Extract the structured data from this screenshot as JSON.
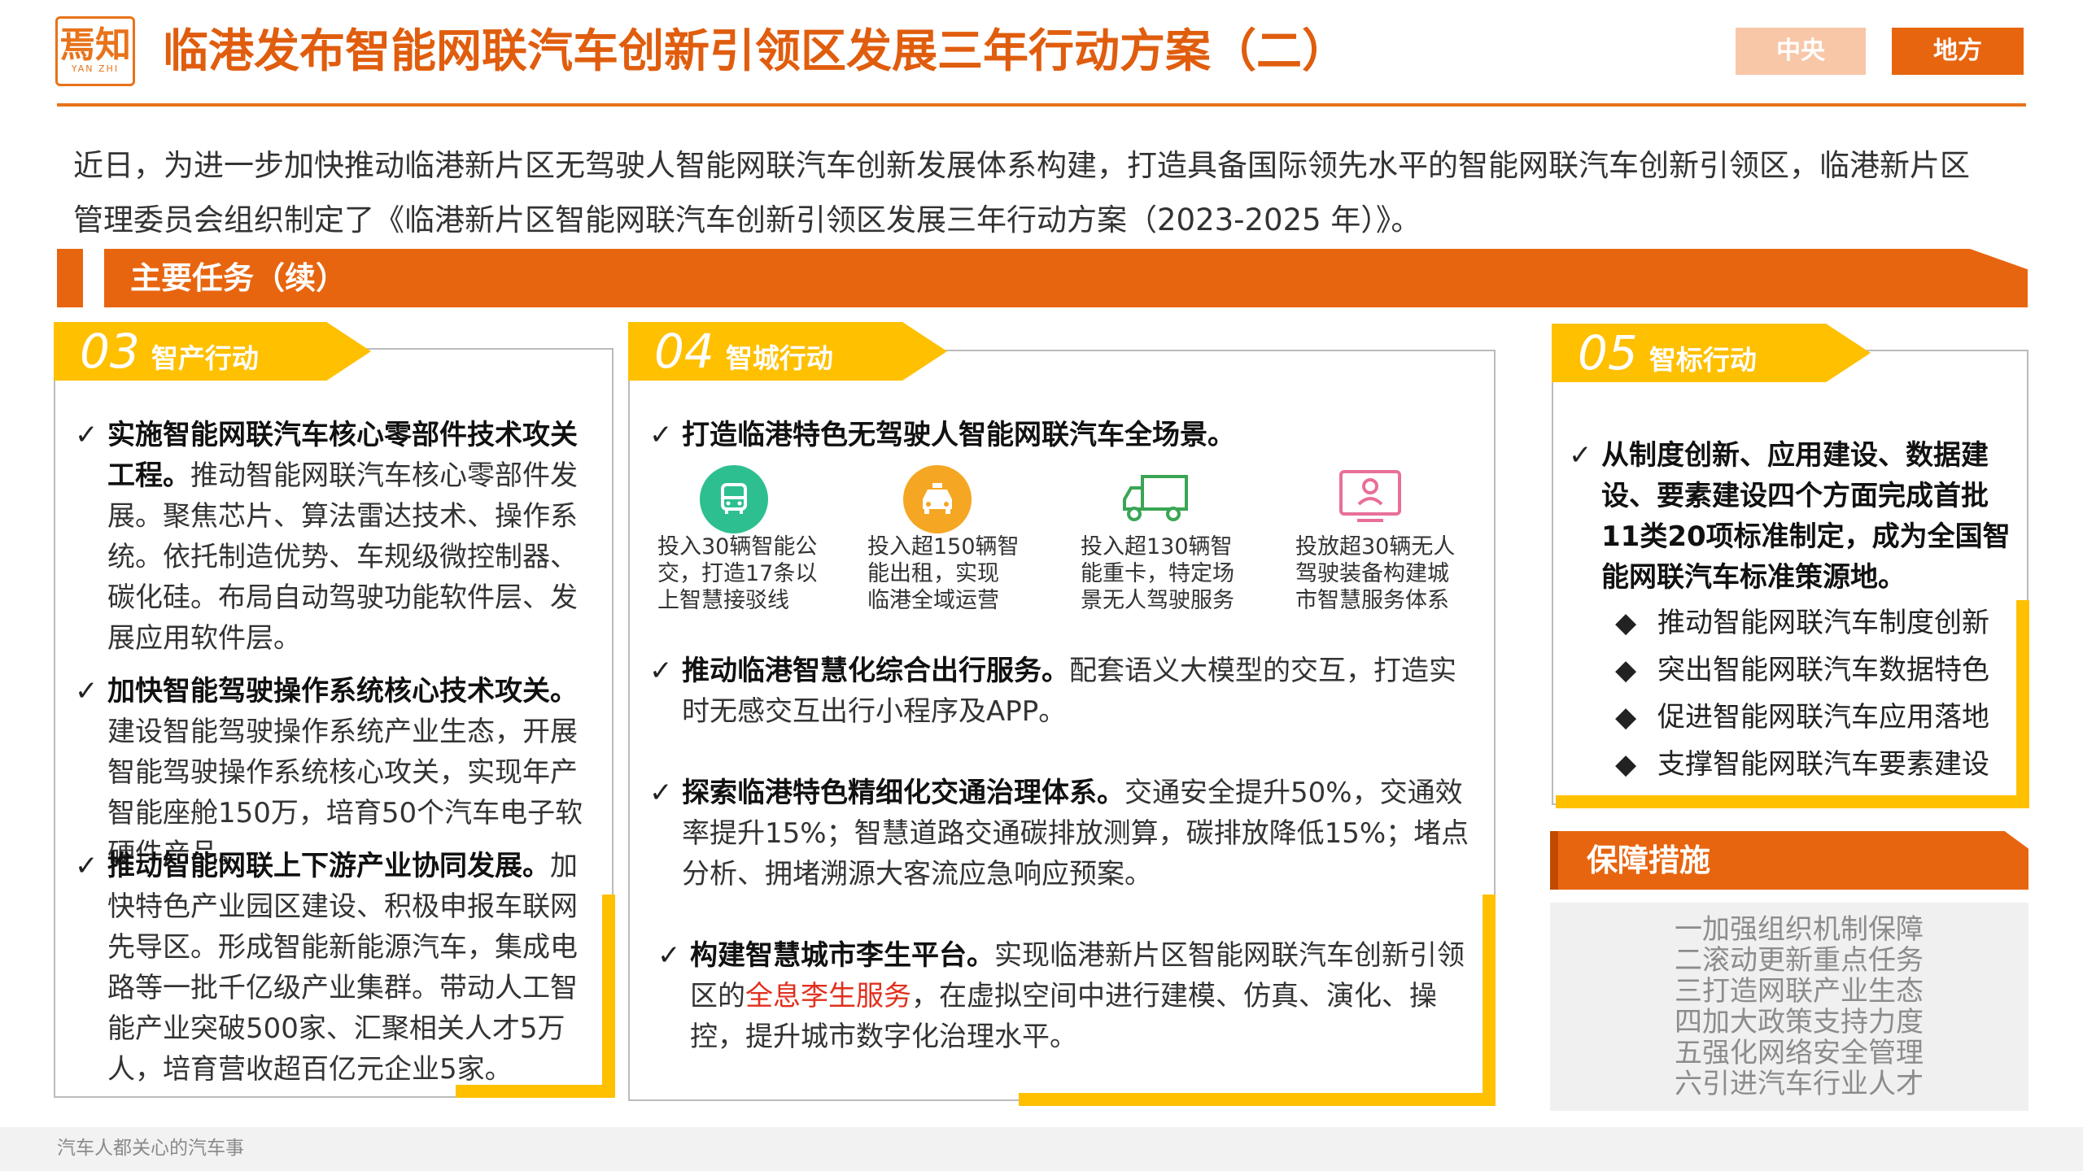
{
  "header": {
    "logo_main": "焉知",
    "logo_sub": "YAN ZHI",
    "title": "临港发布智能网联汽车创新引领区发展三年行动方案（二）",
    "tabs": [
      "中央",
      "地方"
    ]
  },
  "intro": {
    "line1": "近日，为进一步加快推动临港新片区无驾驶人智能网联汽车创新发展体系构建，打造具备国际领先水平的智能网联汽车创新引领区，临港新片区",
    "line2": "管理委员会组织制定了《临港新片区智能网联汽车创新引领区发展三年行动方案（2023-2025 年）》。"
  },
  "section_title": "主要任务（续）",
  "panel03": {
    "num": "03",
    "label": "智产行动",
    "items": [
      {
        "bold": "实施智能网联汽车核心零部件技术攻关工程。",
        "text": "推动智能网联汽车核心零部件发展。聚焦芯片、算法雷达技术、操作系统。依托制造优势、车规级微控制器、碳化硅。布局自动驾驶功能软件层、发展应用软件层。"
      },
      {
        "bold": "加快智能驾驶操作系统核心技术攻关。",
        "text": "建设智能驾驶操作系统产业生态，开展智能驾驶操作系统核心攻关，实现年产智能座舱150万，培育50个汽车电子软硬件产品。"
      },
      {
        "bold": "推动智能网联上下游产业协同发展。",
        "text": "加快特色产业园区建设、积极申报车联网先导区。形成智能新能源汽车，集成电路等一批千亿级产业集群。带动人工智能产业突破500家、汇聚相关人才5万人，培育营收超百亿元企业5家。"
      }
    ]
  },
  "panel04": {
    "num": "04",
    "label": "智城行动",
    "item1_bold": "打造临港特色无驾驶人智能网联汽车全场景。",
    "icons": [
      {
        "icon": "bus-icon",
        "color": "#2ebf91",
        "caption": [
          "投入30辆智能公",
          "交，打造17条以",
          "上智慧接驳线"
        ]
      },
      {
        "icon": "taxi-icon",
        "color": "#f5a623",
        "caption": [
          "投入超150辆智",
          "能出租，实现",
          "临港全域运营"
        ]
      },
      {
        "icon": "truck-icon",
        "color": "#3aa655",
        "caption": [
          "投入超130辆智",
          "能重卡，特定场",
          "景无人驾驶服务"
        ]
      },
      {
        "icon": "monitor-icon",
        "color": "#e86f9a",
        "caption": [
          "投放超30辆无人",
          "驾驶装备构建城",
          "市智慧服务体系"
        ]
      }
    ],
    "item2_bold": "推动临港智慧化综合出行服务。",
    "item2_text": "配套语义大模型的交互，打造实时无感交互出行小程序及APP。",
    "item3_bold": "探索临港特色精细化交通治理体系。",
    "item3_text": "交通安全提升50%，交通效率提升15%；智慧道路交通碳排放测算，碳排放降低15%；堵点分析、拥堵溯源大客流应急响应预案。",
    "item4_bold": "构建智慧城市李生平台。",
    "item4_text_a": "实现临港新片区智能网联汽车创新引领区的",
    "item4_red": "全息李生服务",
    "item4_text_b": "，在虚拟空间中进行建模、仿真、演化、操控，提升城市数字化治理水平。"
  },
  "panel05": {
    "num": "05",
    "label": "智标行动",
    "item_bold": "从制度创新、应用建设、数据建设、要素建设四个方面完成首批11类20项标准制定，成为全国智能网联汽车标准策源地。",
    "bullets": [
      "推动智能网联汽车制度创新",
      "突出智能网联汽车数据特色",
      "促进智能网联汽车应用落地",
      "支撑智能网联汽车要素建设"
    ]
  },
  "guarantee": {
    "title": "保障措施",
    "items": [
      "一加强组织机制保障",
      "二滚动更新重点任务",
      "三打造网联产业生态",
      "四加大政策支持力度",
      "五强化网络安全管理",
      "六引进汽车行业人才"
    ]
  },
  "footer": "汽车人都关心的汽车事",
  "colors": {
    "accent": "#e8650f",
    "yellow": "#ffc000",
    "highlight_red": "#e0301e"
  }
}
